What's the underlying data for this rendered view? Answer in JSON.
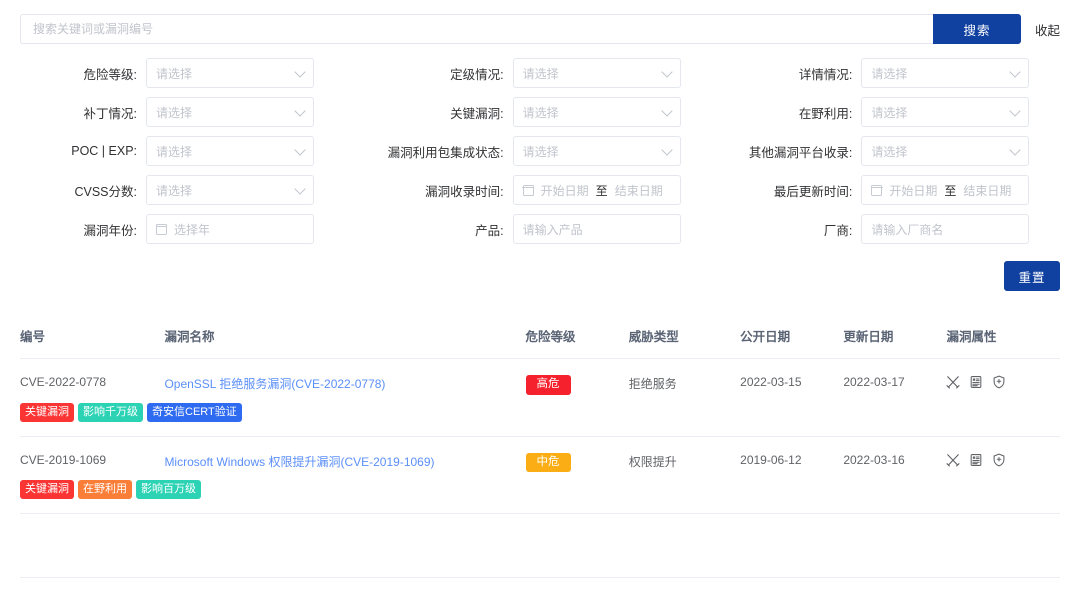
{
  "search": {
    "placeholder": "搜索关键词或漏洞编号",
    "value": "",
    "button_label": "搜索",
    "collapse_label": "收起",
    "accent_color": "#1040a0"
  },
  "filters": {
    "select_placeholder": "请选择",
    "rows": [
      [
        {
          "label": "危险等级:",
          "type": "select",
          "value": "请选择"
        },
        {
          "label": "定级情况:",
          "type": "select",
          "value": "请选择"
        },
        {
          "label": "详情情况:",
          "type": "select",
          "value": "请选择"
        }
      ],
      [
        {
          "label": "补丁情况:",
          "type": "select",
          "value": "请选择"
        },
        {
          "label": "关键漏洞:",
          "type": "select",
          "value": "请选择"
        },
        {
          "label": "在野利用:",
          "type": "select",
          "value": "请选择"
        }
      ],
      [
        {
          "label": "POC | EXP:",
          "type": "select",
          "value": "请选择"
        },
        {
          "label": "漏洞利用包集成状态:",
          "type": "select",
          "value": "请选择"
        },
        {
          "label": "其他漏洞平台收录:",
          "type": "select",
          "value": "请选择"
        }
      ],
      [
        {
          "label": "CVSS分数:",
          "type": "select",
          "value": "请选择"
        },
        {
          "label": "漏洞收录时间:",
          "type": "daterange",
          "start": "开始日期",
          "sep": "至",
          "end": "结束日期"
        },
        {
          "label": "最后更新时间:",
          "type": "daterange",
          "start": "开始日期",
          "sep": "至",
          "end": "结束日期"
        }
      ],
      [
        {
          "label": "漏洞年份:",
          "type": "year",
          "value": "选择年"
        },
        {
          "label": "产品:",
          "type": "text",
          "value": "请输入产品"
        },
        {
          "label": "厂商:",
          "type": "text",
          "value": "请输入厂商名"
        }
      ]
    ],
    "reset_label": "重置"
  },
  "table": {
    "headers": [
      "编号",
      "漏洞名称",
      "危险等级",
      "威胁类型",
      "公开日期",
      "更新日期",
      "漏洞属性"
    ],
    "rows": [
      {
        "id": "CVE-2022-0778",
        "name": "OpenSSL 拒绝服务漏洞(CVE-2022-0778)",
        "level": "高危",
        "level_style": "high",
        "level_color": "#f5222d",
        "threat": "拒绝服务",
        "published": "2022-03-15",
        "updated": "2022-03-17",
        "attr_icons": [
          "crossed-swords-icon",
          "document-icon",
          "shield-patch-icon"
        ],
        "tags": [
          {
            "text": "关键漏洞",
            "style": "red",
            "color": "#fa3534"
          },
          {
            "text": "影响千万级",
            "style": "teal",
            "color": "#2bd3b4"
          },
          {
            "text": "奇安信CERT验证",
            "style": "blue",
            "color": "#2e6bf0"
          }
        ]
      },
      {
        "id": "CVE-2019-1069",
        "name": "Microsoft Windows 权限提升漏洞(CVE-2019-1069)",
        "level": "中危",
        "level_style": "mid",
        "level_color": "#faad14",
        "threat": "权限提升",
        "published": "2019-06-12",
        "updated": "2022-03-16",
        "attr_icons": [
          "crossed-swords-icon",
          "document-icon",
          "shield-patch-icon"
        ],
        "tags": [
          {
            "text": "关键漏洞",
            "style": "red",
            "color": "#fa3534"
          },
          {
            "text": "在野利用",
            "style": "orange",
            "color": "#fa7d38"
          },
          {
            "text": "影响百万级",
            "style": "teal",
            "color": "#2bd3b4"
          }
        ]
      }
    ]
  }
}
